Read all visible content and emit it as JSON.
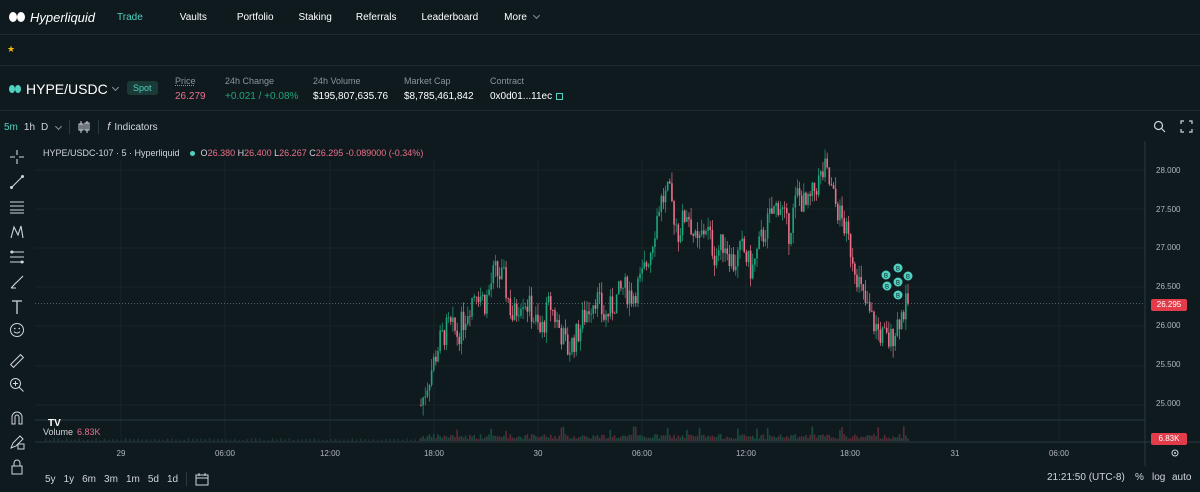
{
  "nav": {
    "logo_text": "Hyperliquid",
    "items": [
      {
        "label": "Trade",
        "active": true
      },
      {
        "label": "Vaults"
      },
      {
        "label": "Portfolio"
      },
      {
        "label": "Staking"
      },
      {
        "label": "Referrals"
      },
      {
        "label": "Leaderboard"
      },
      {
        "label": "More"
      }
    ]
  },
  "favorites": {
    "star": "★"
  },
  "market": {
    "pair": "HYPE/USDC",
    "badge": "Spot",
    "stats": [
      {
        "label": "Price",
        "value": "26.279"
      },
      {
        "label": "24h Change",
        "value": "+0.021 / +0.08%"
      },
      {
        "label": "24h Volume",
        "value": "$195,807,635.76"
      },
      {
        "label": "Market Cap",
        "value": "$8,785,461,842"
      },
      {
        "label": "Contract",
        "value": "0x0d01...11ec"
      }
    ]
  },
  "toolbar": {
    "timeframes": [
      "5m",
      "1h",
      "D"
    ],
    "indicators_label": "Indicators",
    "fx": "f"
  },
  "legend": {
    "title": "HYPE/USDC-107 · 5 · Hyperliquid",
    "o_label": "O",
    "o": "26.380",
    "h_label": "H",
    "h": "26.400",
    "l_label": "L",
    "l": "26.267",
    "c_label": "C",
    "c": "26.295",
    "change": "-0.089000 (-0.34%)"
  },
  "volume": {
    "label": "Volume",
    "value": "6.83K",
    "logo": "TV"
  },
  "axes": {
    "y_ticks": [
      "28.000",
      "27.500",
      "27.000",
      "26.500",
      "26.000",
      "25.500",
      "25.000"
    ],
    "x_ticks": [
      "29",
      "06:00",
      "12:00",
      "18:00",
      "30",
      "06:00",
      "12:00",
      "18:00",
      "31",
      "06:00"
    ],
    "price_tag": "26.295",
    "vol_tag": "6.83K"
  },
  "bottom": {
    "ranges": [
      "5y",
      "1y",
      "6m",
      "3m",
      "1m",
      "5d",
      "1d"
    ],
    "clock": "21:21:50 (UTC-8)",
    "pct": "%",
    "log": "log",
    "auto": "auto"
  },
  "colors": {
    "accent": "#50d2c1",
    "down": "#ed7088",
    "up": "#1fa67d",
    "background": "#0f1a1f"
  },
  "chart_data": {
    "type": "candlestick",
    "ylim": [
      24.8,
      28.2
    ],
    "series": [
      {
        "points": [
          25.0,
          25.4,
          25.8,
          26.0,
          25.9,
          26.2,
          26.5,
          26.3,
          26.7,
          26.6,
          26.1,
          26.4,
          26.2,
          25.9,
          26.3,
          26.0,
          25.7,
          25.9,
          26.2,
          26.4,
          26.1,
          26.3,
          26.5,
          26.4,
          26.6,
          27.0,
          27.6,
          27.7,
          27.2,
          27.5,
          27.0,
          27.3,
          26.9,
          27.1,
          26.8,
          27.0,
          26.7,
          27.1,
          27.4,
          27.6,
          27.2,
          27.7,
          27.5,
          27.8,
          28.0,
          27.6,
          27.3,
          26.9,
          26.4,
          26.1,
          25.9,
          25.8,
          26.1,
          26.3
        ]
      }
    ]
  }
}
